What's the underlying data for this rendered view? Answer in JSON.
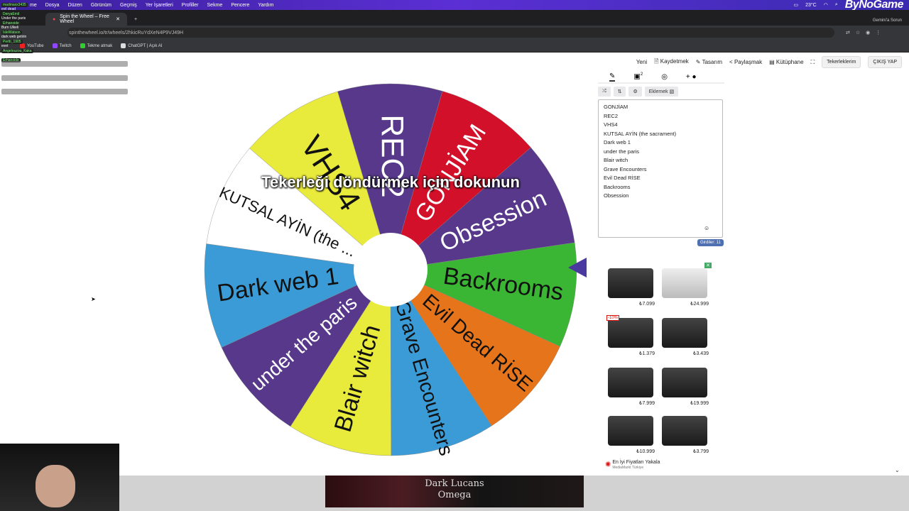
{
  "menubar": {
    "items": [
      "me",
      "Dosya",
      "Düzen",
      "Görünüm",
      "Geçmiş",
      "Yer İşaretleri",
      "Profiller",
      "Sekme",
      "Pencere",
      "Yardım"
    ],
    "temperature": "23°C",
    "brand": "ByNoGame",
    "gemini": "Gemini'a Sorun"
  },
  "tabs": {
    "active": "Spin the Wheel – Free Wheel"
  },
  "address": {
    "url": "spinthewheel.io/tr/wheels/2hkicRuYdXeN4P9VJ49H"
  },
  "bookmarks": [
    "YouTube",
    "Twitch",
    "Tekme atmak",
    "ChatGPT | Açık AI"
  ],
  "chat": [
    {
      "user": "madmaxx3435",
      "msg": "evil dead"
    },
    {
      "user": "DeryaEmil",
      "msg": "Under the paris"
    },
    {
      "user": "Erhanoide",
      "msg": "Burn Ulkeli"
    },
    {
      "user": "IsleWatson",
      "msg": "dark web getirin"
    },
    {
      "user": "Pertti_1905",
      "msg": "evet"
    },
    {
      "user": "Angelouzou_Kaka",
      "msg": "Gecir"
    },
    {
      "user": "Erhanoide",
      "msg": "Her çok sevdiğim"
    }
  ],
  "appbar": {
    "new": "Yeni",
    "save": "Kaydetmek",
    "design": "Tasarım",
    "share": "Paylaşmak",
    "gallery": "Kütüphane",
    "wheels": "Tekerleklerim",
    "logout": "ÇIKIŞ YAP"
  },
  "wheel": {
    "hint": "Tekerleği döndürmek için dokunun",
    "segments": [
      {
        "label": "Obsession",
        "color": "#57388a",
        "text_color": "#ffffff"
      },
      {
        "label": "GONJİAM",
        "color": "#d3102a",
        "text_color": "#ffffff"
      },
      {
        "label": "REC2",
        "color": "#57388a",
        "text_color": "#ffffff"
      },
      {
        "label": "VHS4",
        "color": "#e8ea3c",
        "text_color": "#111111"
      },
      {
        "label": "KUTSAL AYİN (the ...",
        "color": "#ffffff",
        "text_color": "#111111"
      },
      {
        "label": "Dark web 1",
        "color": "#3b9bd6",
        "text_color": "#111111"
      },
      {
        "label": "under the paris",
        "color": "#57388a",
        "text_color": "#ffffff"
      },
      {
        "label": "Blair witch",
        "color": "#e8ea3c",
        "text_color": "#111111"
      },
      {
        "label": "Grave Encounters",
        "color": "#3b9bd6",
        "text_color": "#111111"
      },
      {
        "label": "Evil Dead RİSE",
        "color": "#e6741b",
        "text_color": "#111111"
      },
      {
        "label": "Backrooms",
        "color": "#3bb534",
        "text_color": "#111111"
      }
    ]
  },
  "editor": {
    "entries": [
      "GONJİAM",
      "REC2",
      "VHS4",
      "KUTSAL AYİN (the sacrament)",
      "Dark web 1",
      "under the paris",
      "Blair witch",
      "Grave Encounters",
      "Evil Dead RİSE",
      "Backrooms",
      "Obsession"
    ],
    "add_label": "Eklemek",
    "counter": "Girdiler: 11",
    "results_badge": "2"
  },
  "ads": {
    "prices": [
      "₺7.099",
      "₺24.999",
      "₺1.379",
      "₺3.439",
      "₺7.999",
      "₺19.999",
      "₺10.999",
      "₺3.799"
    ],
    "discount": "-10%",
    "footer_title": "En İyi Fiyatları Yakala",
    "footer_sub": "MediaMarkt Türkiye",
    "banner_line1": "Dark Lucans",
    "banner_line2": "Omega"
  }
}
